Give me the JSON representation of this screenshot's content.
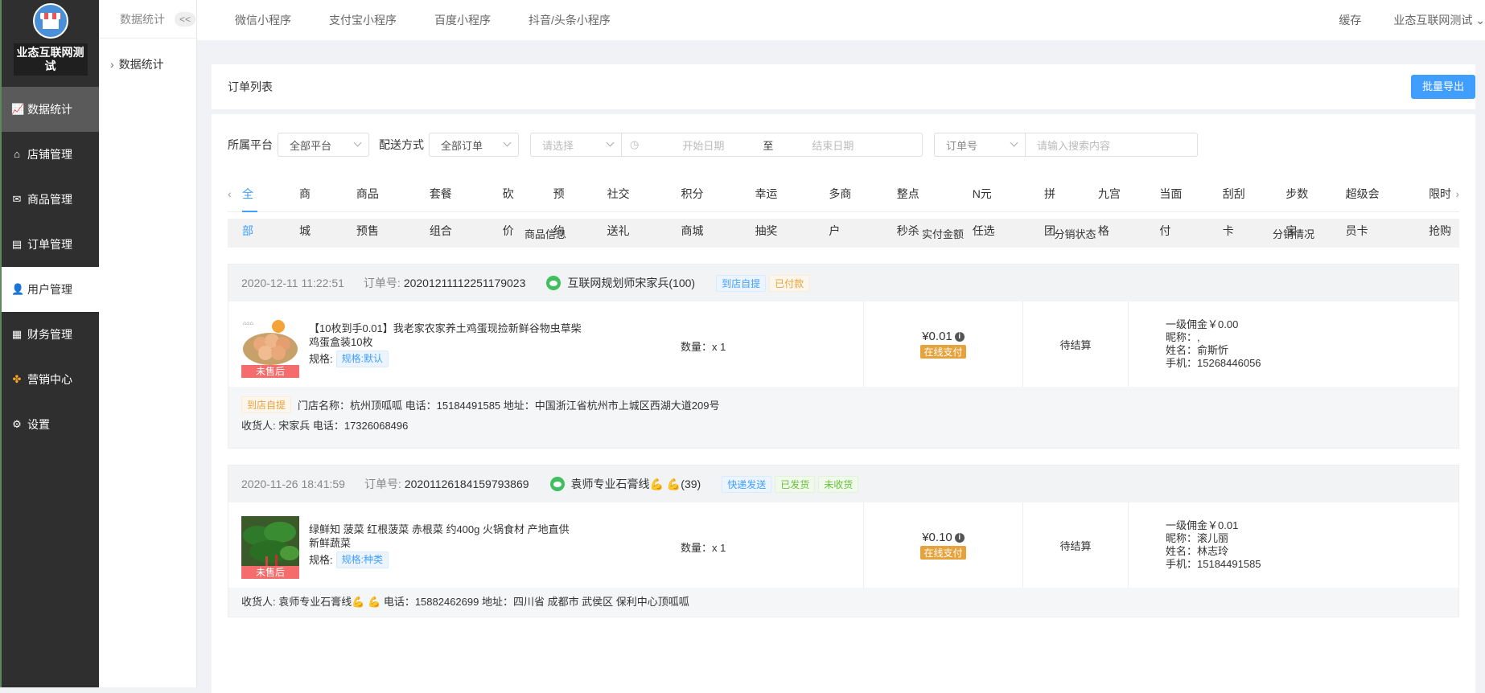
{
  "brand": {
    "name": "业态互联网测试"
  },
  "sidebar": {
    "items": [
      {
        "label": "数据统计",
        "icon": "chart-icon"
      },
      {
        "label": "店铺管理",
        "icon": "shop-icon"
      },
      {
        "label": "商品管理",
        "icon": "goods-icon"
      },
      {
        "label": "订单管理",
        "icon": "order-icon"
      },
      {
        "label": "用户管理",
        "icon": "user-icon"
      },
      {
        "label": "财务管理",
        "icon": "finance-icon"
      },
      {
        "label": "营销中心",
        "icon": "marketing-icon"
      },
      {
        "label": "设置",
        "icon": "gear-icon"
      }
    ]
  },
  "subnav": {
    "title": "数据统计",
    "collapse": "<<",
    "item": "数据统计"
  },
  "topbar": {
    "tabs": [
      "微信小程序",
      "支付宝小程序",
      "百度小程序",
      "抖音/头条小程序"
    ],
    "cache": "缓存",
    "account": "业态互联网测试"
  },
  "page": {
    "title": "订单列表",
    "export_label": "批量导出"
  },
  "filters": {
    "platform_label": "所属平台",
    "platform_value": "全部平台",
    "delivery_label": "配送方式",
    "delivery_value": "全部订单",
    "date_type_placeholder": "请选择",
    "start_placeholder": "开始日期",
    "to": "至",
    "end_placeholder": "结束日期",
    "search_field": "订单号",
    "search_placeholder": "请输入搜索内容"
  },
  "order_tabs": [
    "全部",
    "商城",
    "商品预售",
    "套餐组合",
    "砍价",
    "预约",
    "社交送礼",
    "积分商城",
    "幸运抽奖",
    "多商户",
    "整点秒杀",
    "N元任选",
    "拼团",
    "九宫格",
    "当面付",
    "刮刮卡",
    "步数宝",
    "超级会员卡",
    "限时抢购"
  ],
  "table_headers": {
    "goods": "商品信息",
    "paid": "实付金额",
    "dist_status": "分销状态",
    "dist_info": "分销情况"
  },
  "orders": [
    {
      "time": "2020-12-11 11:22:51",
      "order_no_label": "订单号:",
      "order_no": "20201211112251179023",
      "buyer": "互联网规划师宋家兵(100)",
      "tags": [
        "到店自提",
        "已付款"
      ],
      "goods_title": "【10枚到手0.01】我老家农家养土鸡蛋现捡新鲜谷物虫草柴鸡蛋盒装10枚",
      "spec_label": "规格:",
      "spec": "规格:默认",
      "badge": "未售后",
      "qty": "数量：x 1",
      "price": "¥0.01",
      "pay": "在线支付",
      "status": "待结算",
      "commission": "一级佣金￥0.00",
      "nickname": "昵称：,",
      "name": "姓名：俞斯忻",
      "phone": "手机：15268446056",
      "foot_tag": "到店自提",
      "store": "门店名称：杭州顶呱呱 电话：15184491585 地址：中国浙江省杭州市上城区西湖大道209号",
      "receiver": "收货人: 宋家兵 电话：17326068496"
    },
    {
      "time": "2020-11-26 18:41:59",
      "order_no_label": "订单号:",
      "order_no": "20201126184159793869",
      "buyer": "袁师专业石膏线💪 💪(39)",
      "tags": [
        "快递发送",
        "已发货",
        "未收货"
      ],
      "goods_title": "绿鲜知 菠菜 红根菠菜 赤根菜 约400g 火锅食材 产地直供 新鲜蔬菜",
      "spec_label": "规格:",
      "spec": "规格:种类",
      "badge": "未售后",
      "qty": "数量：x 1",
      "price": "¥0.10",
      "pay": "在线支付",
      "status": "待结算",
      "commission": "一级佣金￥0.01",
      "nickname": "昵称：滚儿丽",
      "name": "姓名：林志玲",
      "phone": "手机：15184491585",
      "receiver": "收货人: 袁师专业石膏线💪 💪 电话：15882462699 地址：四川省 成都市 武侯区 保利中心顶呱呱"
    }
  ],
  "colors": {
    "primary": "#409eff",
    "sidebar": "#2f2f2f",
    "danger": "#f56c6c",
    "warning": "#e6a23c"
  }
}
